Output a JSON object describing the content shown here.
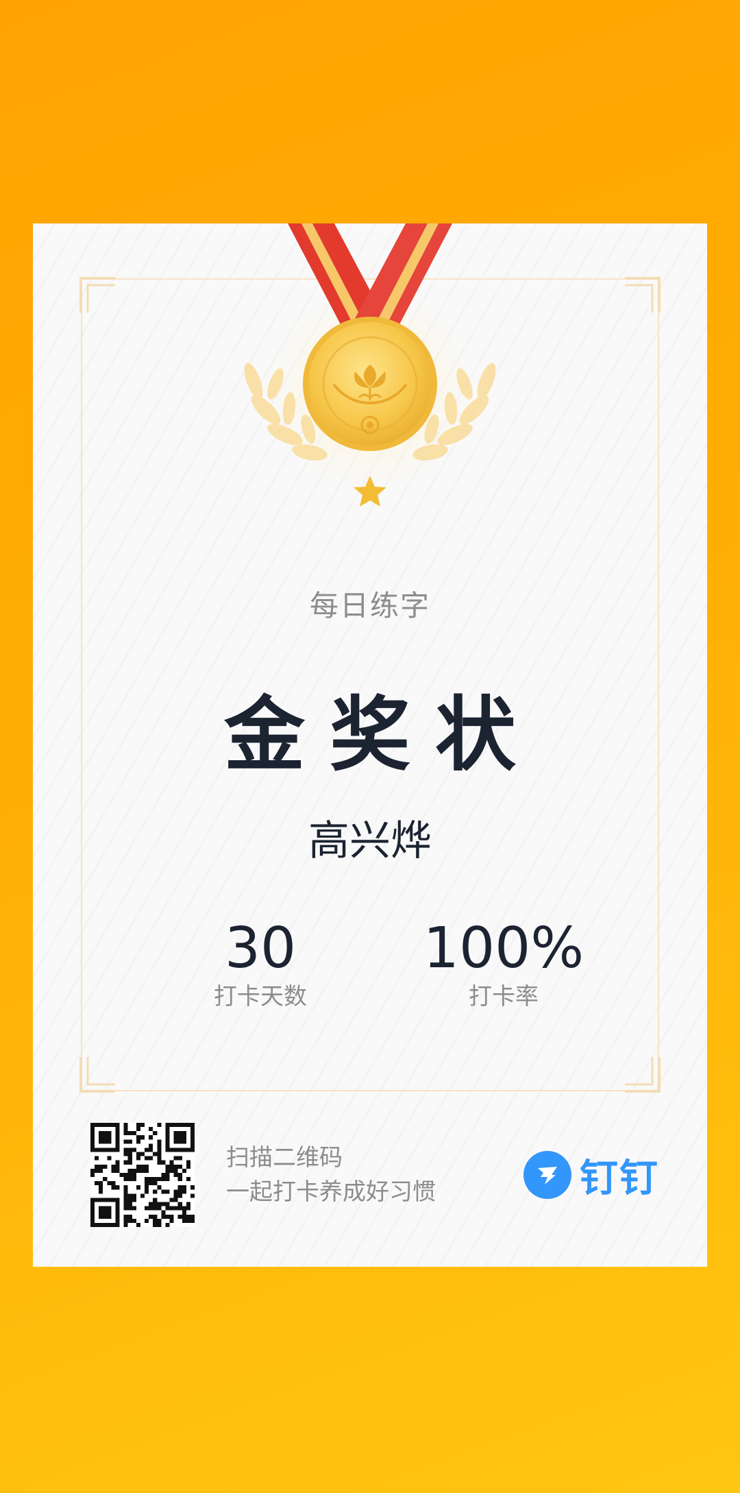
{
  "certificate": {
    "subtitle": "每日练字",
    "title": "金奖状",
    "recipient": "高兴烨"
  },
  "stats": [
    {
      "value": "30",
      "label": "打卡天数"
    },
    {
      "value": "100%",
      "label": "打卡率"
    }
  ],
  "footer": {
    "line1": "扫描二维码",
    "line2": "一起打卡养成好习惯",
    "brand_name": "钉钉"
  },
  "icons": {
    "medal": "gold-medal-icon",
    "laurel": "laurel-wreath-icon",
    "star": "star-icon",
    "qr": "qr-code",
    "brand": "dingtalk-logo-icon"
  },
  "colors": {
    "background_start": "#ffa302",
    "background_end": "#ffc612",
    "card": "#f9f9f9",
    "gold": "#f4c34a",
    "ribbon": "#e23b2e",
    "title": "#1c2331",
    "muted": "#8c8c8c",
    "brand": "#3296fa"
  }
}
